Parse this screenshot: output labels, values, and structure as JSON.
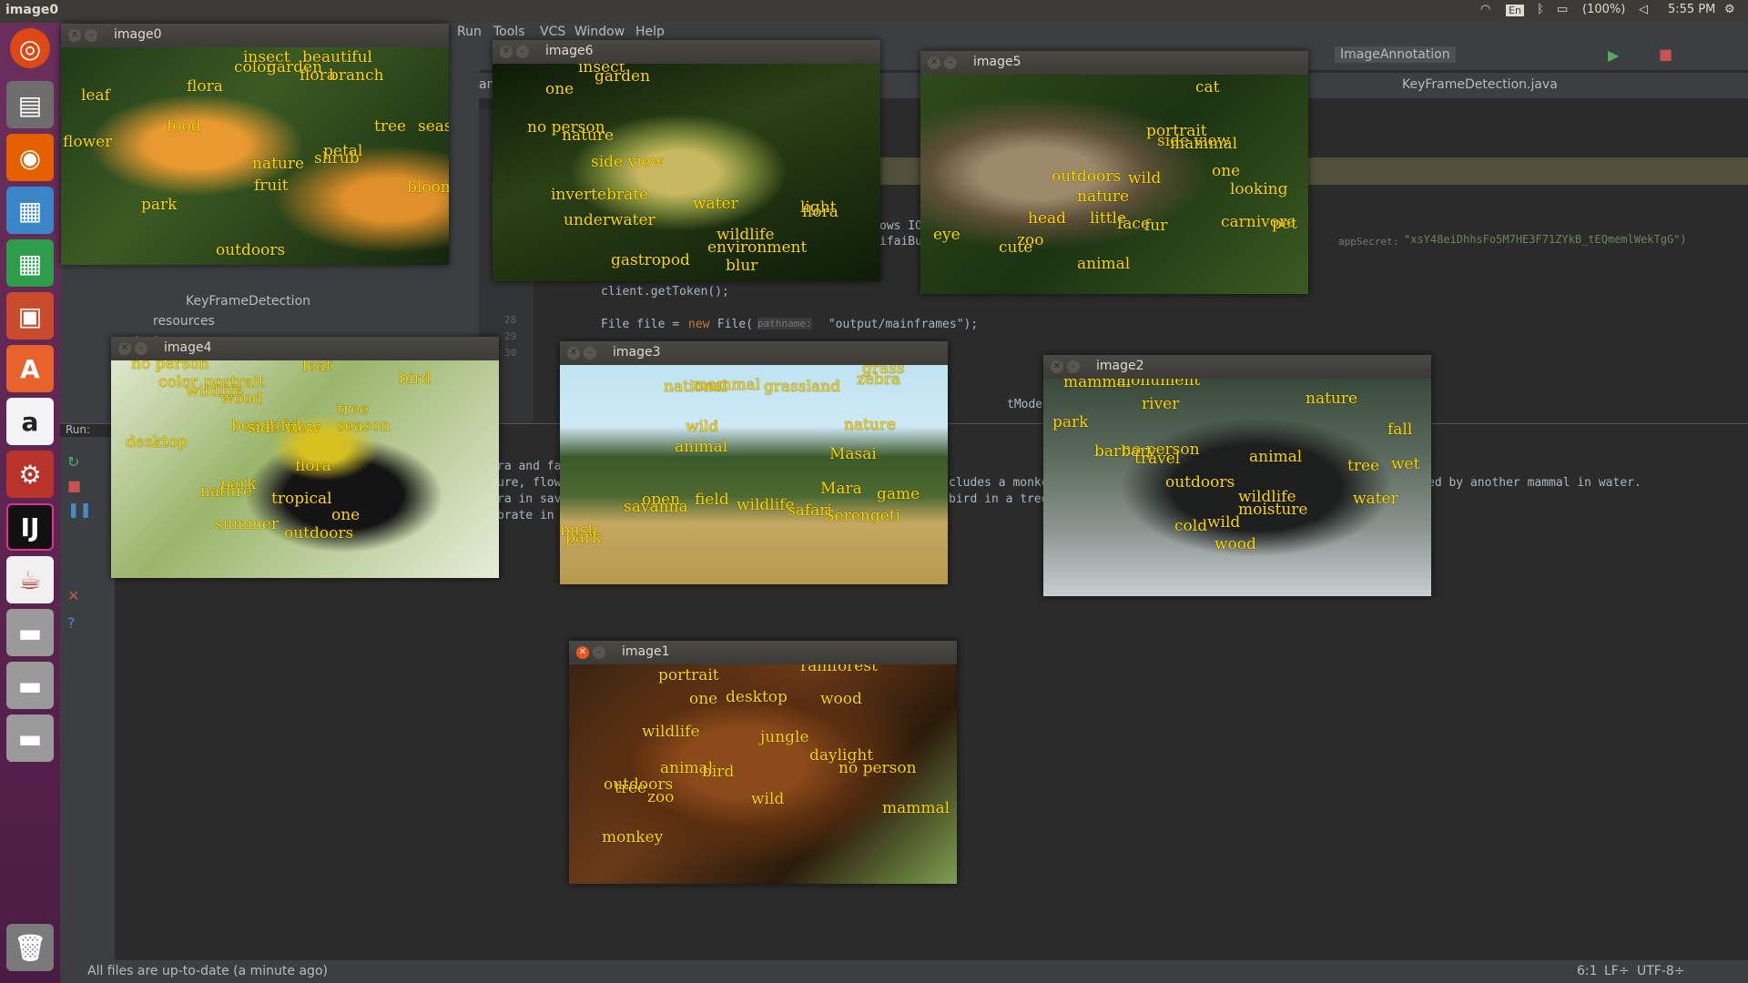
{
  "topbar": {
    "title": "image0",
    "lang": "En",
    "battery": "(100%)",
    "time": "5:55 PM"
  },
  "menu": [
    "Run",
    "Tools",
    "VCS",
    "Window",
    "Help"
  ],
  "toolbar": {
    "config": "ImageAnnotation"
  },
  "tabs": {
    "t1": "annota",
    "t2": "KeyFrameDetection.java"
  },
  "project": {
    "item1": "KeyFrameDetection",
    "item2": "resources",
    "item3": "test"
  },
  "editor": {
    "l28": "28",
    "l29": "29",
    "l30": "30",
    "line28": "client.getToken();",
    "line30a": "File file = ",
    "line30b": "new",
    "line30c": " File(",
    "line30hint": "pathname:",
    "line30d": " \"output/mainframes\");",
    "frag1": "ows IO",
    "frag2": "ifaiBu",
    "secretHint": "appSecret:",
    "secretVal": "\"xsY48eiDhhsFo5M7HE3F71ZYkB_tEQmemlWekTgG\")",
    "frag3": "tModels().gen"
  },
  "run": {
    "label": "Run:",
    "l1": "ra and fa",
    "l2": "ure, flow",
    "l3": "ra in sav",
    "l4": "brate in",
    "r1": "cludes a monke",
    "r2": "bird in a tree",
    "r3": "ed by another mammal in water."
  },
  "status": {
    "msg": "All files are up-to-date (a minute ago)",
    "pos": "6:1",
    "lf": "LF÷",
    "enc": "UTF-8÷"
  },
  "windows": [
    {
      "title": "image0",
      "tags": [
        "insect",
        "beautiful",
        "color",
        "garden",
        "flora",
        "branch",
        "leaf",
        "flora",
        "food",
        "tree",
        "season",
        "flower",
        "nature",
        "shrub",
        "petal",
        "park",
        "fruit",
        "bloom",
        "outdoors"
      ]
    },
    {
      "title": "image6",
      "tags": [
        "insect",
        "garden",
        "one",
        "no person",
        "nature",
        "side view",
        "invertebrate",
        "water",
        "light",
        "flora",
        "underwater",
        "wildlife",
        "environment",
        "gastropod",
        "blur"
      ]
    },
    {
      "title": "image5",
      "tags": [
        "cat",
        "portrait",
        "side view",
        "mammal",
        "outdoors",
        "wild",
        "one",
        "nature",
        "looking",
        "head",
        "little",
        "fur",
        "face",
        "carnivore",
        "eye",
        "zoo",
        "cute",
        "pet",
        "animal"
      ]
    },
    {
      "title": "image4",
      "tags": [
        "no person",
        "leaf",
        "color",
        "portrait",
        "wildlife",
        "wood",
        "bird",
        "tree",
        "season",
        "beautiful",
        "side view",
        "desktop",
        "flora",
        "park",
        "nature",
        "tropical",
        "one",
        "summer",
        "outdoors"
      ]
    },
    {
      "title": "image3",
      "tags": [
        "grass",
        "national",
        "mammal",
        "grassland",
        "zebra",
        "wild",
        "nature",
        "animal",
        "Masai",
        "Mara",
        "open",
        "field",
        "savanna",
        "wildlife",
        "safari",
        "game",
        "Serengeti",
        "bush",
        "park"
      ]
    },
    {
      "title": "image2",
      "tags": [
        "mammal",
        "monument",
        "river",
        "nature",
        "park",
        "fall",
        "no person",
        "barbary",
        "travel",
        "animal",
        "tree",
        "wet",
        "outdoors",
        "wildlife",
        "moisture",
        "water",
        "cold",
        "wild",
        "wood"
      ]
    },
    {
      "title": "image1",
      "tags": [
        "rainforest",
        "portrait",
        "one",
        "desktop",
        "wood",
        "wildlife",
        "jungle",
        "daylight",
        "animal",
        "bird",
        "no person",
        "outdoors",
        "tree",
        "zoo",
        "wild",
        "mammal",
        "monkey"
      ]
    }
  ],
  "colors": {
    "tag": "#ffd700",
    "launcher": "#5a2350",
    "ide": "#2b2b2b",
    "accent": "#e95420"
  }
}
